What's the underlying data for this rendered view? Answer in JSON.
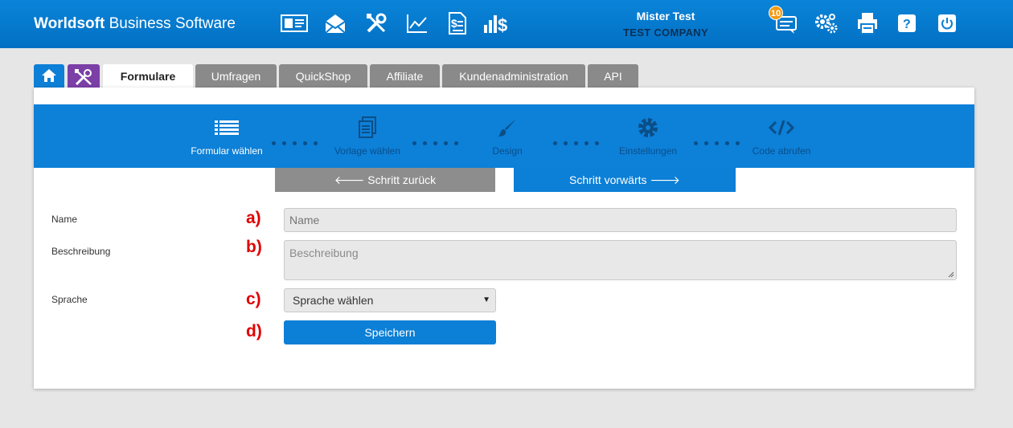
{
  "header": {
    "brand_bold": "Worldsoft",
    "brand_rest": " Business Software",
    "user_name": "Mister Test",
    "company": "TEST COMPANY",
    "notification_count": "10",
    "icons": [
      "contact-card-icon",
      "mail-icon",
      "tools-icon",
      "chart-icon",
      "invoice-icon",
      "revenue-icon",
      "messages-icon",
      "settings-icon",
      "print-icon",
      "help-icon",
      "power-icon"
    ]
  },
  "tabs": [
    {
      "label": "Formulare",
      "active": true
    },
    {
      "label": "Umfragen"
    },
    {
      "label": "QuickShop"
    },
    {
      "label": "Affiliate"
    },
    {
      "label": "Kundenadministration"
    },
    {
      "label": "API"
    }
  ],
  "steps": [
    {
      "label": "Formular wählen",
      "active": true,
      "icon": "list-icon"
    },
    {
      "label": "Vorlage wählen",
      "icon": "document-icon"
    },
    {
      "label": "Design",
      "icon": "brush-icon"
    },
    {
      "label": "Einstellungen",
      "icon": "gear-icon"
    },
    {
      "label": "Code abrufen",
      "icon": "code-icon"
    }
  ],
  "nav": {
    "back_label": "🡐 Schritt zurück",
    "forward_label": "Schritt vorwärts 🡒"
  },
  "form": {
    "name_label": "Name",
    "name_placeholder": "Name",
    "description_label": "Beschreibung",
    "description_placeholder": "Beschreibung",
    "language_label": "Sprache",
    "language_selected": "Sprache wählen",
    "save_label": "Speichern"
  },
  "markers": [
    "a)",
    "b)",
    "c)",
    "d)"
  ],
  "colors": {
    "header": "#0a7fd4",
    "accent": "#0c7fd6",
    "tools_tab": "#7b3fa6",
    "marker": "#e00000"
  }
}
